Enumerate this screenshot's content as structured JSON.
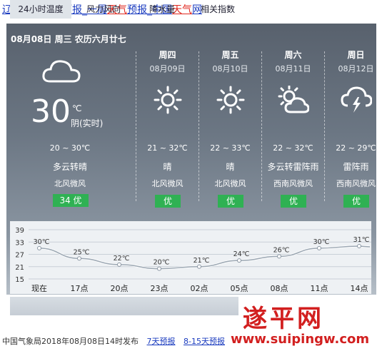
{
  "title_links": {
    "p1": "辽宁",
    "p2": "沈阳",
    "p3": "天气",
    "p4": "预报_一周",
    "p5": "天气",
    "p6": "预报_中国",
    "p7": "天气",
    "p8": "网"
  },
  "today": {
    "date_header": "08月08日 周三 农历六月廿七",
    "temp": "30",
    "unit": "℃",
    "state": "阴(实时)",
    "range": "20 ~ 30℃",
    "condition": "多云转晴",
    "wind": "北风微风",
    "aqi": "34 优",
    "icon": "cloud-icon"
  },
  "forecast": [
    {
      "dow": "周四",
      "date": "08月09日",
      "icon": "sun-icon",
      "range": "21 ~ 32℃",
      "condition": "晴",
      "wind": "北风微风",
      "aqi": "优"
    },
    {
      "dow": "周五",
      "date": "08月10日",
      "icon": "sun-icon",
      "range": "22 ~ 33℃",
      "condition": "晴",
      "wind": "北风微风",
      "aqi": "优"
    },
    {
      "dow": "周六",
      "date": "08月11日",
      "icon": "partly-cloudy-icon",
      "range": "22 ~ 32℃",
      "condition": "多云转雷阵雨",
      "wind": "西南风微风",
      "aqi": "优"
    },
    {
      "dow": "周日",
      "date": "08月12日",
      "icon": "thunderstorm-icon",
      "range": "22 ~ 29℃",
      "condition": "雷阵雨",
      "wind": "西南风微风",
      "aqi": "优"
    }
  ],
  "chart_data": {
    "type": "line",
    "x": [
      "现在",
      "17点",
      "20点",
      "23点",
      "02点",
      "05点",
      "08点",
      "11点",
      "14点"
    ],
    "values": [
      30,
      25,
      22,
      20,
      21,
      24,
      26,
      30,
      31
    ],
    "value_labels": [
      "30℃",
      "25℃",
      "22℃",
      "20℃",
      "21℃",
      "24℃",
      "26℃",
      "30℃",
      "31℃"
    ],
    "yticks": [
      "39",
      "33",
      "27",
      "21",
      "15"
    ],
    "ylim": [
      15,
      39
    ],
    "grid": true
  },
  "tabs": [
    "24小时温度",
    "风力风向",
    "降水量",
    "相关指数"
  ],
  "footer": {
    "publish": "中国气象局2018年08月08日14时发布",
    "link7": "7天预报",
    "link15": "8-15天预报"
  },
  "watermark": {
    "text": "遂平网",
    "url": "www.suipingw.com"
  }
}
